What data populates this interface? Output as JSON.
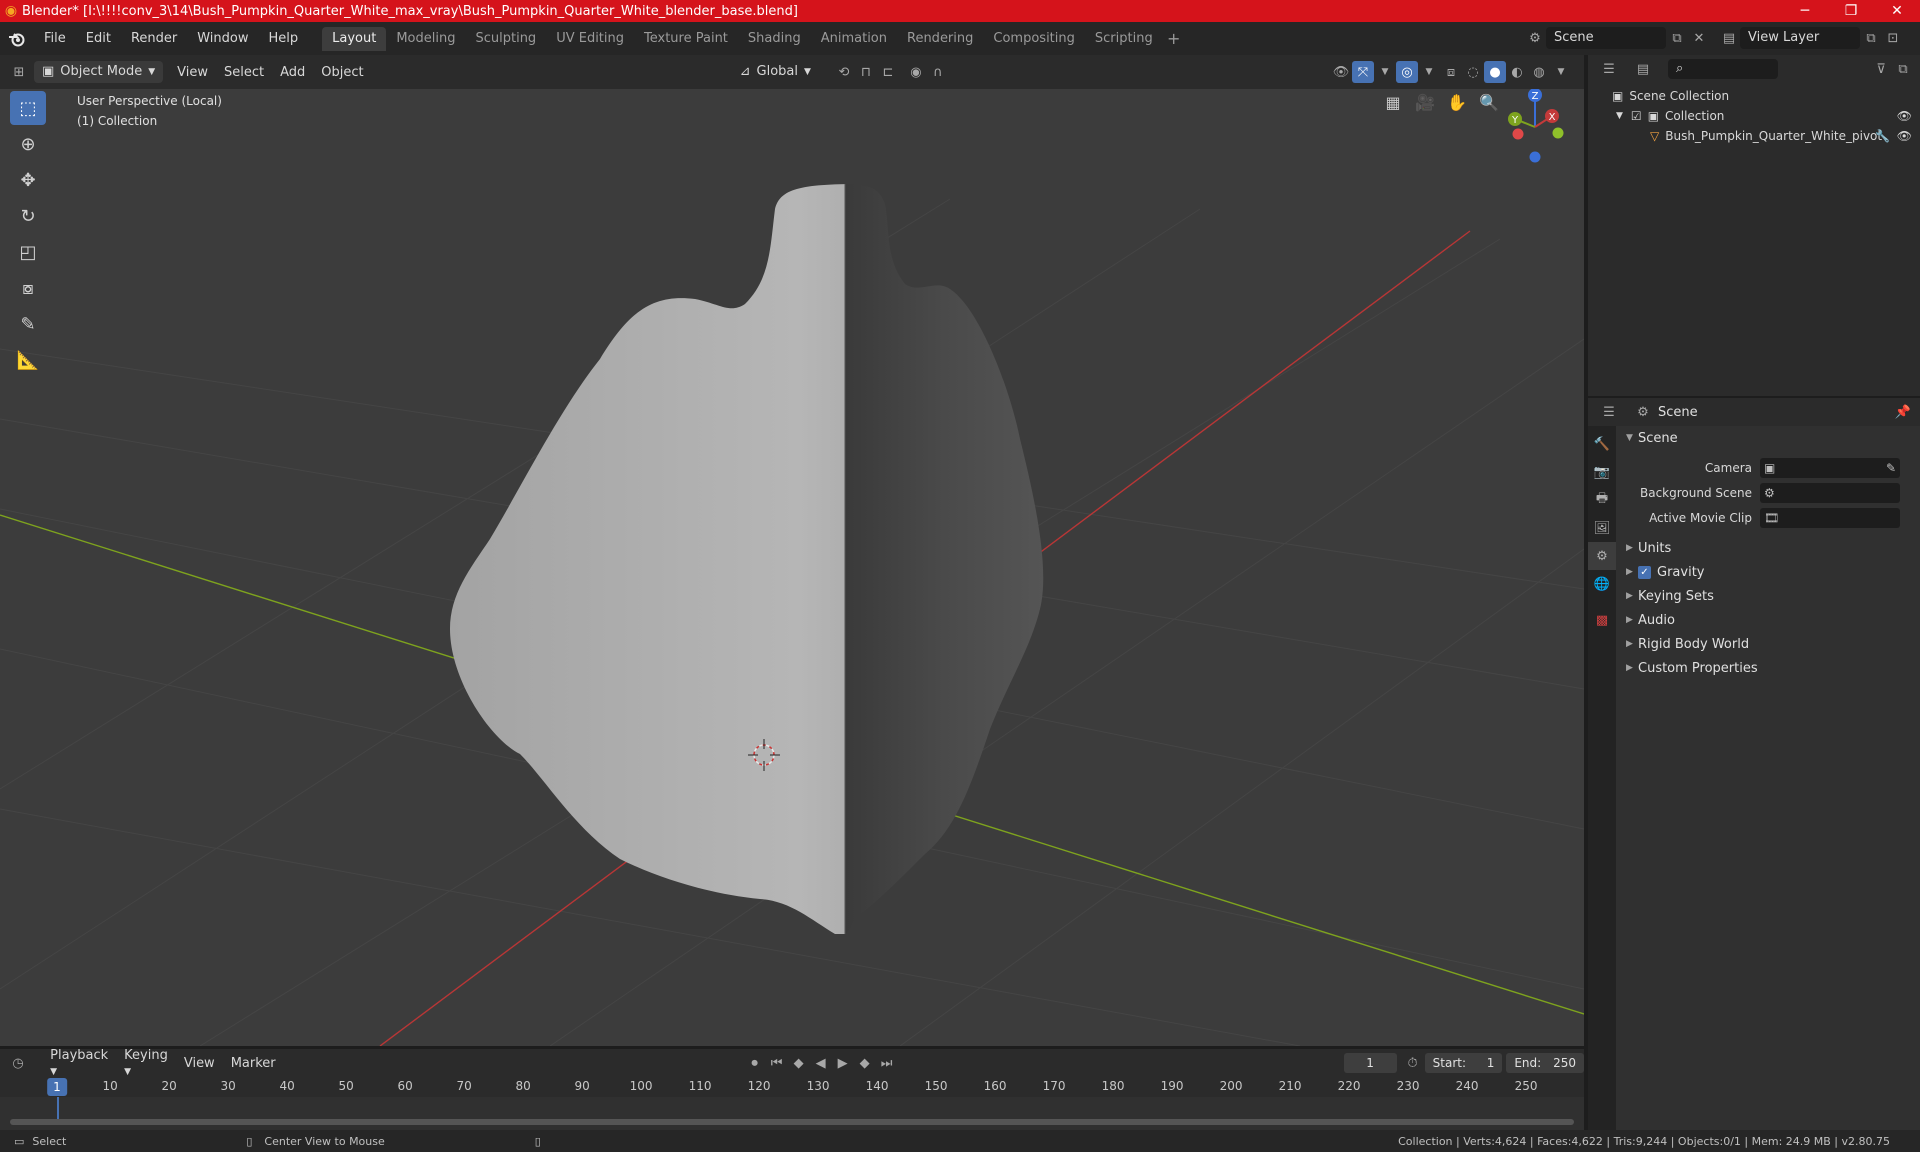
{
  "window": {
    "title": "Blender* [I:\\!!!!conv_3\\14\\Bush_Pumpkin_Quarter_White_max_vray\\Bush_Pumpkin_Quarter_White_blender_base.blend]",
    "minimize": "─",
    "maximize": "❐",
    "close": "✕"
  },
  "menubar": {
    "items": [
      "File",
      "Edit",
      "Render",
      "Window",
      "Help"
    ],
    "workspaces": [
      "Layout",
      "Modeling",
      "Sculpting",
      "UV Editing",
      "Texture Paint",
      "Shading",
      "Animation",
      "Rendering",
      "Compositing",
      "Scripting"
    ],
    "active_workspace": "Layout",
    "add_workspace": "+",
    "scene": "Scene",
    "view_layer": "View Layer"
  },
  "viewport_header": {
    "mode": "Object Mode",
    "menus": [
      "View",
      "Select",
      "Add",
      "Object"
    ],
    "transform_orientation": "Global"
  },
  "viewport": {
    "perspective_label": "User Perspective (Local)",
    "collection_label": "(1) Collection",
    "gizmo": {
      "x": "X",
      "y": "Y",
      "z": "Z"
    }
  },
  "outliner": {
    "root": "Scene Collection",
    "collection": "Collection",
    "object": "Bush_Pumpkin_Quarter_White_pivot"
  },
  "properties": {
    "header_title": "Scene",
    "section_scene": "Scene",
    "fields": [
      {
        "label": "Camera",
        "value": ""
      },
      {
        "label": "Background Scene",
        "value": ""
      },
      {
        "label": "Active Movie Clip",
        "value": ""
      }
    ],
    "subsections": [
      "Units",
      "Gravity",
      "Keying Sets",
      "Audio",
      "Rigid Body World",
      "Custom Properties"
    ],
    "gravity_checked": true
  },
  "timeline": {
    "menus": [
      "Playback",
      "Keying",
      "View",
      "Marker"
    ],
    "current_frame": "1",
    "start_label": "Start:",
    "start": "1",
    "end_label": "End:",
    "end": "250",
    "ruler_ticks": [
      "10",
      "20",
      "30",
      "40",
      "50",
      "60",
      "70",
      "80",
      "90",
      "100",
      "110",
      "120",
      "130",
      "140",
      "150",
      "160",
      "170",
      "180",
      "190",
      "200",
      "210",
      "220",
      "230",
      "240",
      "250"
    ],
    "playhead": "1"
  },
  "statusbar": {
    "select": "Select",
    "center_view": "Center View to Mouse",
    "stats": "Collection | Verts:4,624 | Faces:4,622 | Tris:9,244 | Objects:0/1 | Mem: 24.9 MB | v2.80.75"
  },
  "colors": {
    "accent": "#4772b3",
    "titlebar": "#d5131b",
    "x_axis": "#c33a3a",
    "y_axis": "#7ea31e",
    "viewport_bg": "#3c3c3c"
  }
}
